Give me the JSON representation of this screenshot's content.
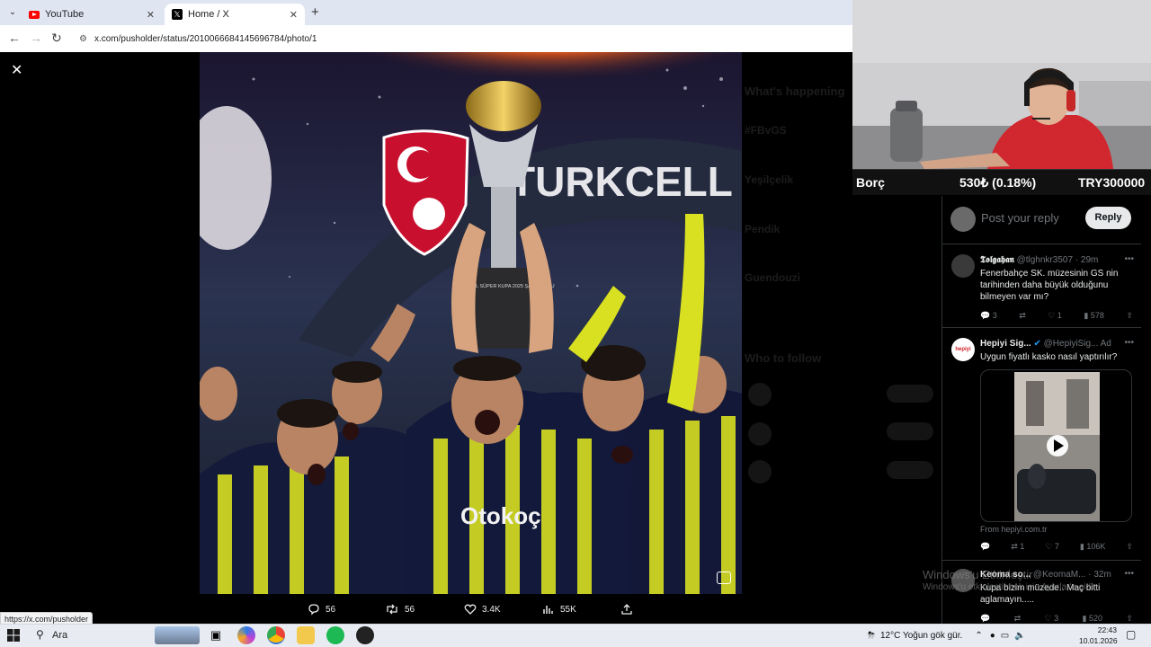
{
  "browser": {
    "tabs": [
      {
        "label": "YouTube"
      },
      {
        "label": "Home / X"
      }
    ],
    "url": "x.com/pusholder/status/2010066684145696784/photo/1",
    "status_url": "https://x.com/pusholder"
  },
  "photo": {
    "banner_text": "TURKCELL S",
    "trophy_text": "TURKCELL SÜPER KUPA 2025 ŞAMPİYONU",
    "jersey_sponsor": "Otokoç"
  },
  "photo_actions": {
    "replies": "56",
    "reposts": "56",
    "likes": "3.4K",
    "views": "55K"
  },
  "reply_compose": {
    "placeholder": "Post your reply",
    "button": "Reply"
  },
  "replies": [
    {
      "name": "𝕿𝖔𝖑𝖌𝖆𝖍𝖆𝖓",
      "handle": "@tlghnkr3507",
      "time": "· 29m",
      "text": "Fenerbahçe SK. müzesinin GS nin tarihinden daha büyük olduğunu bilmeyen var mı?",
      "stats": {
        "replies": "3",
        "reposts": "",
        "likes": "1",
        "views": "578"
      }
    },
    {
      "name": "Hepiyi Sig...",
      "handle": "@HepiyiSig...",
      "time": "Ad",
      "avatar_text": "hepiyi",
      "text": "Uygun fiyatlı kasko nasıl yaptırılır?",
      "from": "From hepiyi.com.tr",
      "stats": {
        "replies": "",
        "reposts": "1",
        "likes": "7",
        "views": "106K"
      }
    },
    {
      "name": "Keoma so...",
      "handle": "@KeomaM...",
      "time": "· 32m",
      "text": "Kupa bizim müzede.. Maç bitti aglamayın.....",
      "stats": {
        "replies": "",
        "reposts": "",
        "likes": "3",
        "views": "520"
      }
    }
  ],
  "sidebar_dimmed": {
    "heading": "What's happening",
    "who_to_follow": "Who to follow",
    "trends": [
      "#FBvGS",
      "Yeşilçelik",
      "Pendik",
      "Guendouzi"
    ]
  },
  "stream_overlay": {
    "label": "Borç",
    "change": "530₺ (0.18%)",
    "total": "TRY300000"
  },
  "windows": {
    "watermark_title": "Windows'u Etkinleştir",
    "watermark_sub": "Windows'u etkinleştirmek için Ayarlar'a gidin.",
    "search_placeholder": "Ara",
    "weather": "12°C  Yoğun gök gür.",
    "time": "22:43",
    "date": "10.01.2026"
  }
}
